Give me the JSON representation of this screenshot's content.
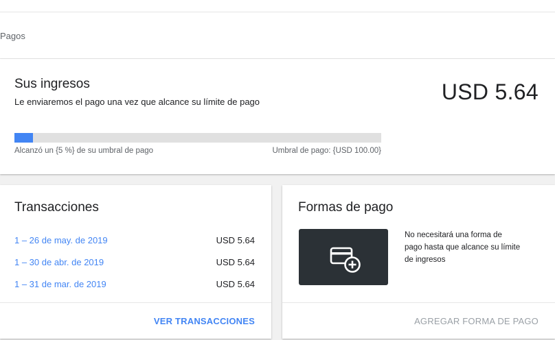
{
  "breadcrumb": "Pagos",
  "earnings": {
    "title": "Sus ingresos",
    "subtitle": "Le enviaremos el pago una vez que alcance su límite de pago",
    "amount": "USD 5.64",
    "progress_fraction": 0.05,
    "progress_left": "Alcanzó un {5 %} de su umbral de pago",
    "progress_right": "Umbral de pago: {USD 100.00}"
  },
  "transactions": {
    "title": "Transacciones",
    "rows": [
      {
        "date": "1 – 26 de may. de 2019",
        "amount": "USD 5.64"
      },
      {
        "date": "1 – 30 de abr. de 2019",
        "amount": "USD 5.64"
      },
      {
        "date": "1 – 31 de mar. de 2019",
        "amount": "USD 5.64"
      }
    ],
    "action": "VER TRANSACCIONES"
  },
  "payment_methods": {
    "title": "Formas de pago",
    "icon": "add-card-icon",
    "message": "No necesitará una forma de pago hasta que alcance su límite de ingresos",
    "action": "AGREGAR FORMA DE PAGO"
  },
  "colors": {
    "accent": "#4285f4",
    "track": "#e0e0e0",
    "card_tile": "#2b3136"
  }
}
